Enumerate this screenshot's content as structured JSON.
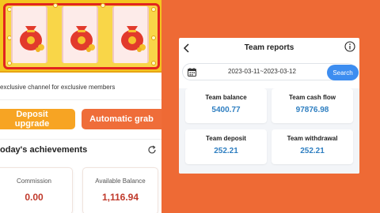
{
  "left": {
    "slot_reels": [
      "money-bag-icon",
      "money-bag-icon",
      "money-bag-icon"
    ],
    "channel_text": "exclusive channel for exclusive members",
    "deposit_button": "Deposit upgrade",
    "auto_grab_button": "Automatic grab",
    "achievements_title": "oday's achievements",
    "stats": [
      {
        "label": "Commission",
        "value": "0.00"
      },
      {
        "label": "Available Balance",
        "value": "1,116.94"
      }
    ]
  },
  "report": {
    "title": "Team reports",
    "date_range": "2023-03-11~2023-03-12",
    "search_label": "Search",
    "metrics": [
      {
        "label": "Team balance",
        "value": "5400.77"
      },
      {
        "label": "Team cash flow",
        "value": "97876.98"
      },
      {
        "label": "Team deposit",
        "value": "252.21"
      },
      {
        "label": "Team withdrawal",
        "value": "252.21"
      }
    ]
  },
  "colors": {
    "background": "#ee6a35",
    "deposit_button": "#f7a423",
    "auto_grab_button": "#ef6d39",
    "search_button": "#3d8df0",
    "metric_value": "#2f7fc1",
    "stat_value": "#c0392b"
  }
}
